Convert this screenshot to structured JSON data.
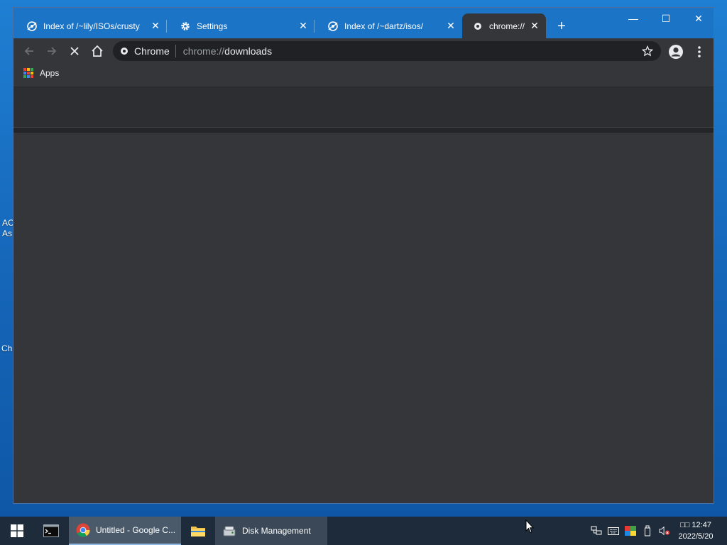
{
  "desktop": {
    "fragments": [
      "AC",
      "As",
      "Ch"
    ]
  },
  "browser": {
    "tabs": [
      {
        "title": "Index of /~lily/ISOs/crusty",
        "icon": "site-favicon"
      },
      {
        "title": "Settings",
        "icon": "gear-icon"
      },
      {
        "title": "Index of /~dartz/isos/",
        "icon": "site-favicon"
      },
      {
        "title": "chrome://",
        "icon": "chrome-page-icon",
        "active": true
      }
    ],
    "close_glyph": "✕",
    "new_tab_glyph": "+",
    "window_controls": {
      "minimize": "—",
      "maximize": "☐",
      "close": "✕"
    },
    "omnibox": {
      "chip_label": "Chrome",
      "url_scheme": "chrome://",
      "url_path": "downloads"
    },
    "bookmarks": {
      "apps_label": "Apps"
    },
    "colors": {
      "titlebar": "#1c74c7",
      "frame": "#35363a",
      "omnibox": "#202124"
    }
  },
  "taskbar": {
    "tasks": [
      {
        "label": "Untitled - Google C...",
        "icon": "chrome-icon"
      },
      {
        "label": "Disk Management",
        "icon": "disk-management-icon"
      }
    ],
    "clock": {
      "time": "□□ 12:47",
      "date": "2022/5/20"
    }
  }
}
